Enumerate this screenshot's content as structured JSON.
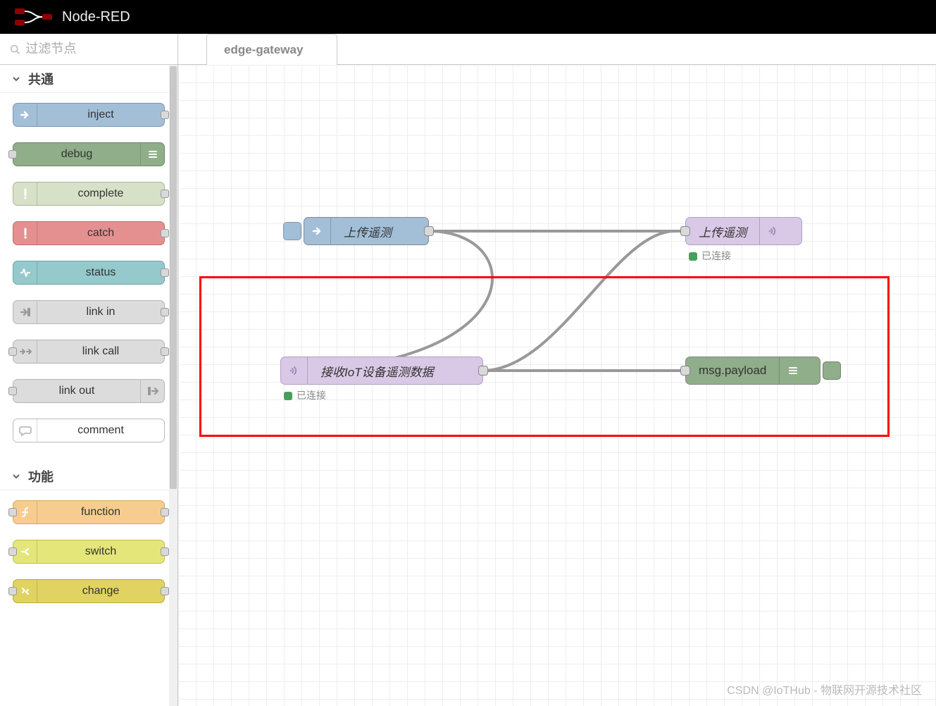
{
  "header": {
    "title": "Node-RED"
  },
  "sidebar": {
    "filter_placeholder": "过滤节点",
    "categories": [
      {
        "label": "共通",
        "nodes": [
          {
            "key": "inject",
            "label": "inject",
            "color": "c-blue",
            "icon": "arrow-right",
            "iconSide": "left",
            "portIn": false,
            "portOut": true
          },
          {
            "key": "debug",
            "label": "debug",
            "color": "c-green",
            "icon": "bars",
            "iconSide": "right",
            "portIn": true,
            "portOut": false
          },
          {
            "key": "complete",
            "label": "complete",
            "color": "c-grey",
            "icon": "excl",
            "iconSide": "left",
            "portIn": false,
            "portOut": true
          },
          {
            "key": "catch",
            "label": "catch",
            "color": "c-red",
            "icon": "excl",
            "iconSide": "left",
            "portIn": false,
            "portOut": true
          },
          {
            "key": "status",
            "label": "status",
            "color": "c-teal",
            "icon": "pulse",
            "iconSide": "left",
            "portIn": false,
            "portOut": true
          },
          {
            "key": "link-in",
            "label": "link in",
            "color": "c-lgrey",
            "icon": "link-in",
            "iconSide": "left",
            "portIn": false,
            "portOut": true
          },
          {
            "key": "link-call",
            "label": "link call",
            "color": "c-lgrey",
            "icon": "link-call",
            "iconSide": "left",
            "portIn": true,
            "portOut": true
          },
          {
            "key": "link-out",
            "label": "link out",
            "color": "c-lgrey",
            "icon": "link-out",
            "iconSide": "right",
            "portIn": true,
            "portOut": false
          },
          {
            "key": "comment",
            "label": "comment",
            "color": "c-white",
            "icon": "comment",
            "iconSide": "left",
            "portIn": false,
            "portOut": false
          }
        ]
      },
      {
        "label": "功能",
        "nodes": [
          {
            "key": "function",
            "label": "function",
            "color": "c-orange",
            "icon": "fn",
            "iconSide": "left",
            "portIn": true,
            "portOut": true
          },
          {
            "key": "switch",
            "label": "switch",
            "color": "c-yellow",
            "icon": "switch",
            "iconSide": "left",
            "portIn": true,
            "portOut": true
          },
          {
            "key": "change",
            "label": "change",
            "color": "c-ylw2",
            "icon": "change",
            "iconSide": "left",
            "portIn": true,
            "portOut": true
          }
        ]
      }
    ]
  },
  "workspace": {
    "tabs": [
      {
        "label": "edge-gateway"
      }
    ],
    "nodes": {
      "inject1": {
        "label": "上传遥测"
      },
      "mqttout": {
        "label": "上传遥测",
        "status": "已连接"
      },
      "mqttin": {
        "label": "接收IoT设备遥测数据",
        "status": "已连接"
      },
      "debug1": {
        "label": "msg.payload"
      }
    }
  },
  "watermark": "CSDN @IoTHub - 物联网开源技术社区"
}
